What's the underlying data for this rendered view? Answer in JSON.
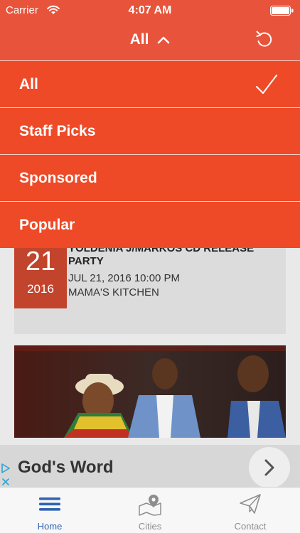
{
  "status_bar": {
    "carrier": "Carrier",
    "time": "4:07 AM",
    "wifi_icon": "wifi-icon",
    "battery_icon": "battery-icon"
  },
  "nav": {
    "title": "All",
    "title_icon": "chevron-up-icon",
    "action_icon": "refresh-icon"
  },
  "filter_menu": {
    "items": [
      {
        "label": "All",
        "selected": true
      },
      {
        "label": "Staff Picks",
        "selected": false
      },
      {
        "label": "Sponsored",
        "selected": false
      },
      {
        "label": "Popular",
        "selected": false
      }
    ],
    "selected_icon": "checkmark-icon"
  },
  "events": [
    {
      "day": "21",
      "year": "2016",
      "title": "YOLDENIA J/MARKOS CD RELEASE PARTY",
      "datetime": "JUL 21, 2016 10:00 PM",
      "venue": "MAMA'S KITCHEN"
    }
  ],
  "ad": {
    "title": "God's Word",
    "play_icon": "ad-choices-icon",
    "close_icon": "close-icon",
    "next_icon": "chevron-right-icon"
  },
  "tabs": [
    {
      "label": "Home",
      "icon": "menu-lines-icon",
      "active": true
    },
    {
      "label": "Cities",
      "icon": "map-pin-icon",
      "active": false
    },
    {
      "label": "Contact",
      "icon": "paper-plane-icon",
      "active": false
    }
  ],
  "colors": {
    "accent": "#e8543b",
    "menu": "#ee4a28",
    "date_badge": "#c2442c",
    "active_tab": "#2f64b3"
  }
}
